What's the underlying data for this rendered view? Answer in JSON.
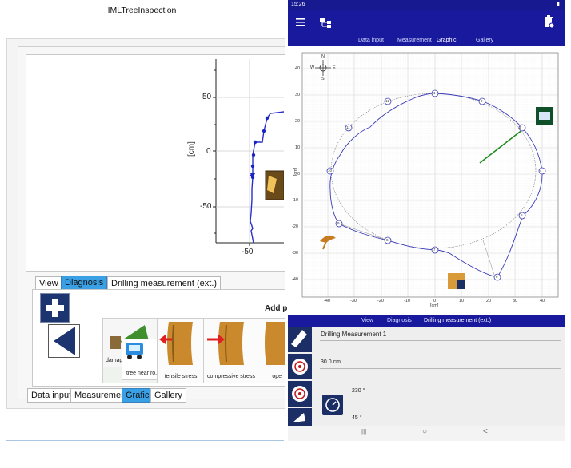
{
  "desktop": {
    "title": "IMLTreeInspection",
    "plot": {
      "ylabel": "[cm]",
      "yticks": [
        "50",
        "0",
        "-50"
      ],
      "xticks": [
        "-50"
      ]
    },
    "diag_tabs": [
      "View",
      "Diagnosis",
      "Drilling measurement (ext.)"
    ],
    "add_label": "Add p",
    "cards": {
      "damaged": "damaged",
      "tree_near_road": "tree near ro...",
      "tensile": "tensile stress",
      "compressive": "compressive stress",
      "ope": "ope"
    },
    "bottom_tabs": [
      "Data input",
      "Measurement",
      "Grafic",
      "Gallery"
    ]
  },
  "tablet": {
    "status_time": "15:26",
    "tabs": [
      "Data input",
      "Measurement",
      "Graphic",
      "Gallery"
    ],
    "compass": {
      "n": "N",
      "s": "S",
      "e": "E",
      "w": "W"
    },
    "yticks": [
      "40",
      "30",
      "20",
      "10",
      "0",
      "-10",
      "-20",
      "-30",
      "-40"
    ],
    "xticks": [
      "-40",
      "-30",
      "-20",
      "-10",
      "0",
      "10",
      "20",
      "30",
      "40"
    ],
    "xunit": "[cm]",
    "yunit": "[cm]",
    "points": [
      "1",
      "2",
      "3",
      "4",
      "5",
      "6",
      "7",
      "8",
      "9",
      "10",
      "11",
      "12"
    ],
    "sub_tabs": [
      "View",
      "Diagnosis",
      "Drilling measurement (ext.)"
    ],
    "drilling_title": "Drilling Measurement 1",
    "depth": "30.0 cm",
    "angle1": "230 °",
    "angle2": "45 °",
    "nav": {
      "recent": "|||",
      "home": "○",
      "back": "<"
    },
    "colors": {
      "primary": "#18199d",
      "accent": "#ffffff",
      "line": "#3a3ab8",
      "green": "#1e8a1e"
    }
  }
}
